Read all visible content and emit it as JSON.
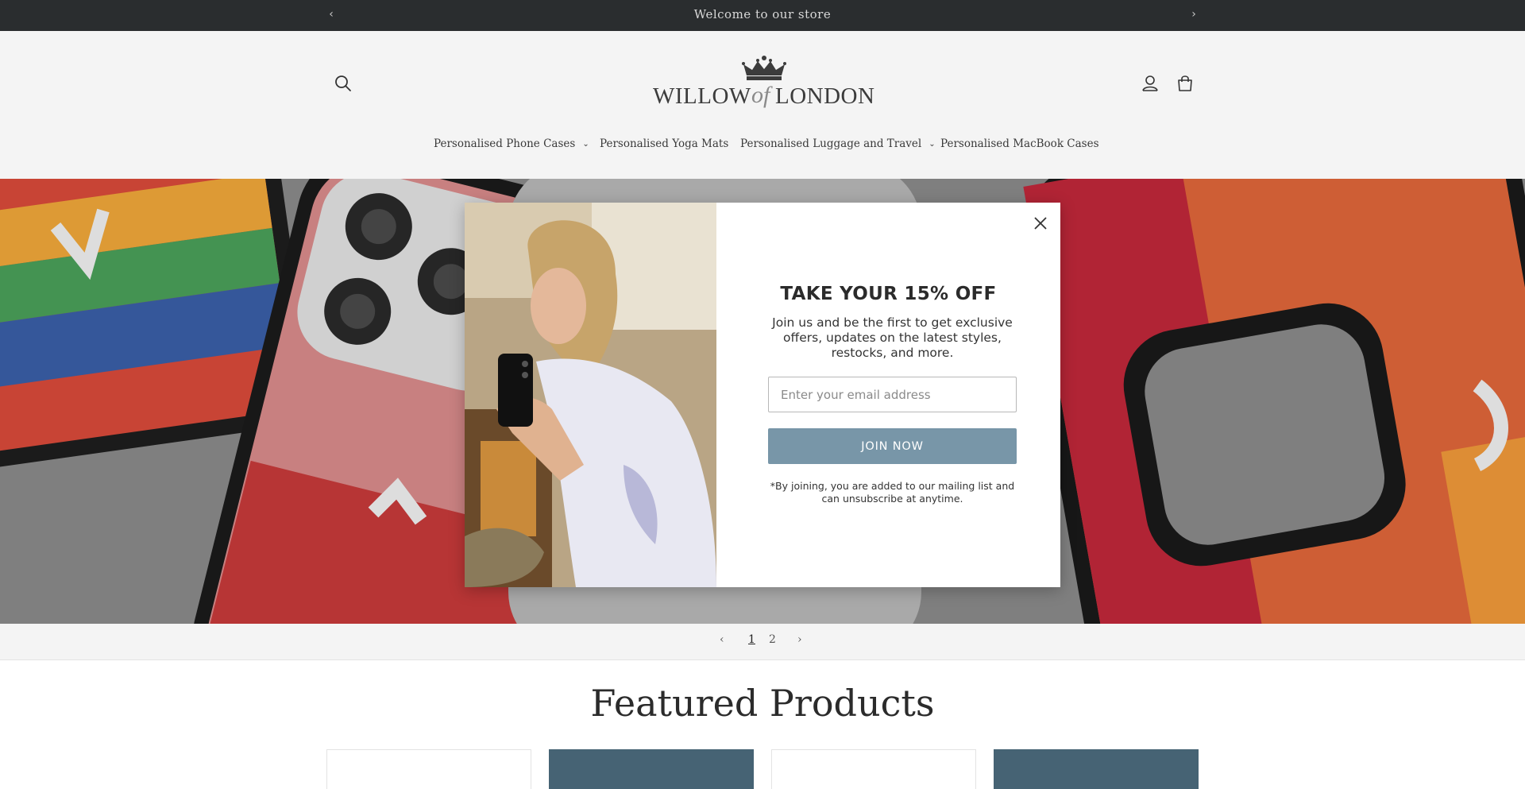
{
  "announcement": {
    "message": "Welcome to our store",
    "prev_icon": "chevron-left-icon",
    "next_icon": "chevron-right-icon",
    "background": "#2a2d2f"
  },
  "header": {
    "logo": {
      "word_left": "WILLOW",
      "word_mid": "of",
      "word_right": "LONDON"
    },
    "icons": [
      "search-icon",
      "account-icon",
      "cart-icon"
    ]
  },
  "nav": {
    "items": [
      {
        "label": "Personalised Phone Cases",
        "has_dropdown": true
      },
      {
        "label": "Personalised Yoga Mats",
        "has_dropdown": false
      },
      {
        "label": "Personalised Luggage and Travel",
        "has_dropdown": true
      },
      {
        "label": "Personalised MacBook Cases",
        "has_dropdown": false
      }
    ]
  },
  "slider": {
    "prev_icon": "chevron-left-icon",
    "pages": [
      "1",
      "2"
    ],
    "current_page": "1",
    "next_icon": "chevron-right-icon"
  },
  "featured": {
    "title": "Featured Products"
  },
  "popup": {
    "title": "TAKE YOUR 15% OFF",
    "body": "Join us and be the first to get exclusive offers, updates on the latest styles, restocks, and more.",
    "email_placeholder": "Enter your email address",
    "button_label": "JOIN NOW",
    "note": "*By joining, you are added to our mailing list and can unsubscribe at anytime.",
    "button_color": "#7896a8"
  }
}
